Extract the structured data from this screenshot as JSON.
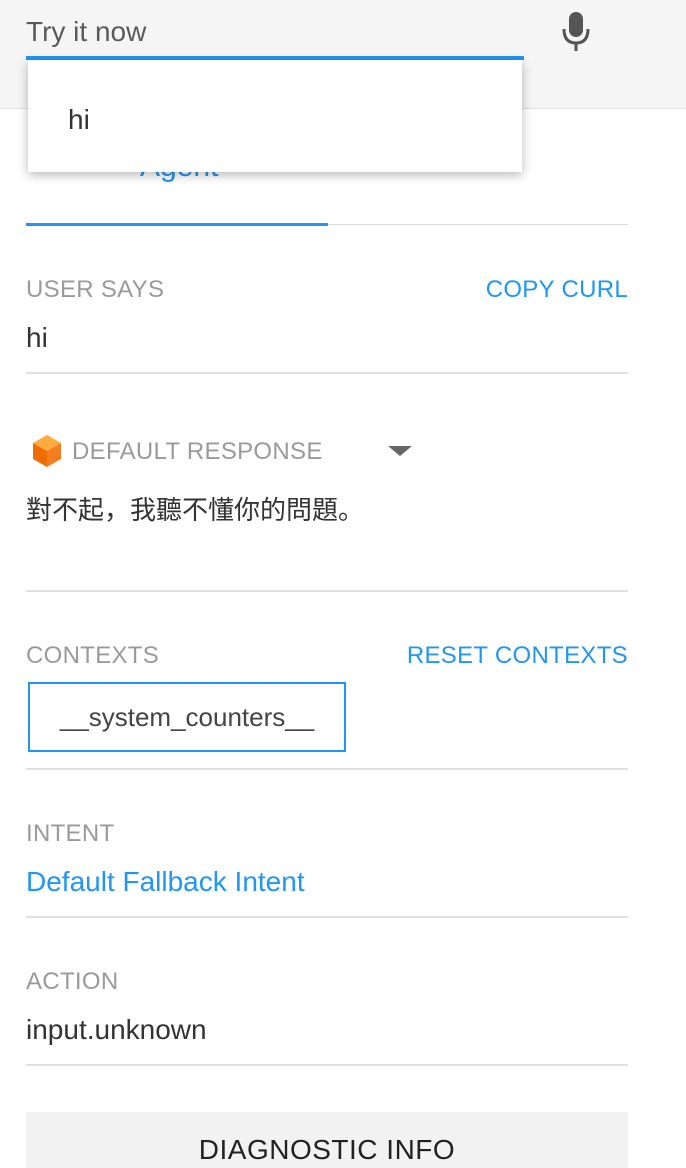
{
  "search": {
    "placeholder": "Try it now",
    "value": ""
  },
  "mic": {
    "icon": "microphone-icon"
  },
  "suggestion": {
    "text": "hi"
  },
  "tabs": {
    "active_label": "Agent"
  },
  "user_says": {
    "label": "USER SAYS",
    "copy_curl": "COPY CURL",
    "value": "hi"
  },
  "response": {
    "label": "DEFAULT RESPONSE",
    "icon": "cube-icon",
    "text": "對不起，我聽不懂你的問題。"
  },
  "contexts": {
    "label": "CONTEXTS",
    "reset": "RESET CONTEXTS",
    "items": [
      "__system_counters__"
    ]
  },
  "intent": {
    "label": "INTENT",
    "value": "Default Fallback Intent"
  },
  "action": {
    "label": "ACTION",
    "value": "input.unknown"
  },
  "diagnostic": {
    "label": "DIAGNOSTIC INFO"
  },
  "colors": {
    "accent": "#2196f3",
    "icon_orange": "#f57c1f"
  }
}
